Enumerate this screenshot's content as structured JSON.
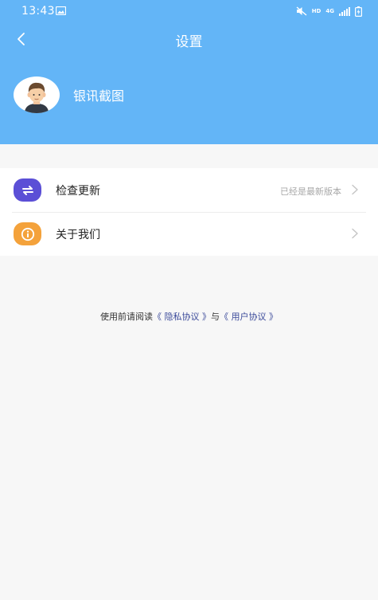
{
  "status_bar": {
    "time": "13:43",
    "network_hd": "HD",
    "network_4g": "4G"
  },
  "nav": {
    "title": "设置"
  },
  "profile": {
    "name": "银讯截图"
  },
  "menu": {
    "items": [
      {
        "label": "检查更新",
        "value": "已经是最新版本",
        "icon": "refresh-icon",
        "color": "#5b4fd6"
      },
      {
        "label": "关于我们",
        "value": "",
        "icon": "info-icon",
        "color": "#f4a23b"
      }
    ]
  },
  "agreement": {
    "prefix": "使用前请阅读",
    "privacy_link": "《 隐私协议 》",
    "connector": "与",
    "user_link": "《 用户协议 》"
  },
  "colors": {
    "header_bg": "#63b5f7",
    "page_bg": "#f7f7f7",
    "link": "#3b4a9a"
  }
}
